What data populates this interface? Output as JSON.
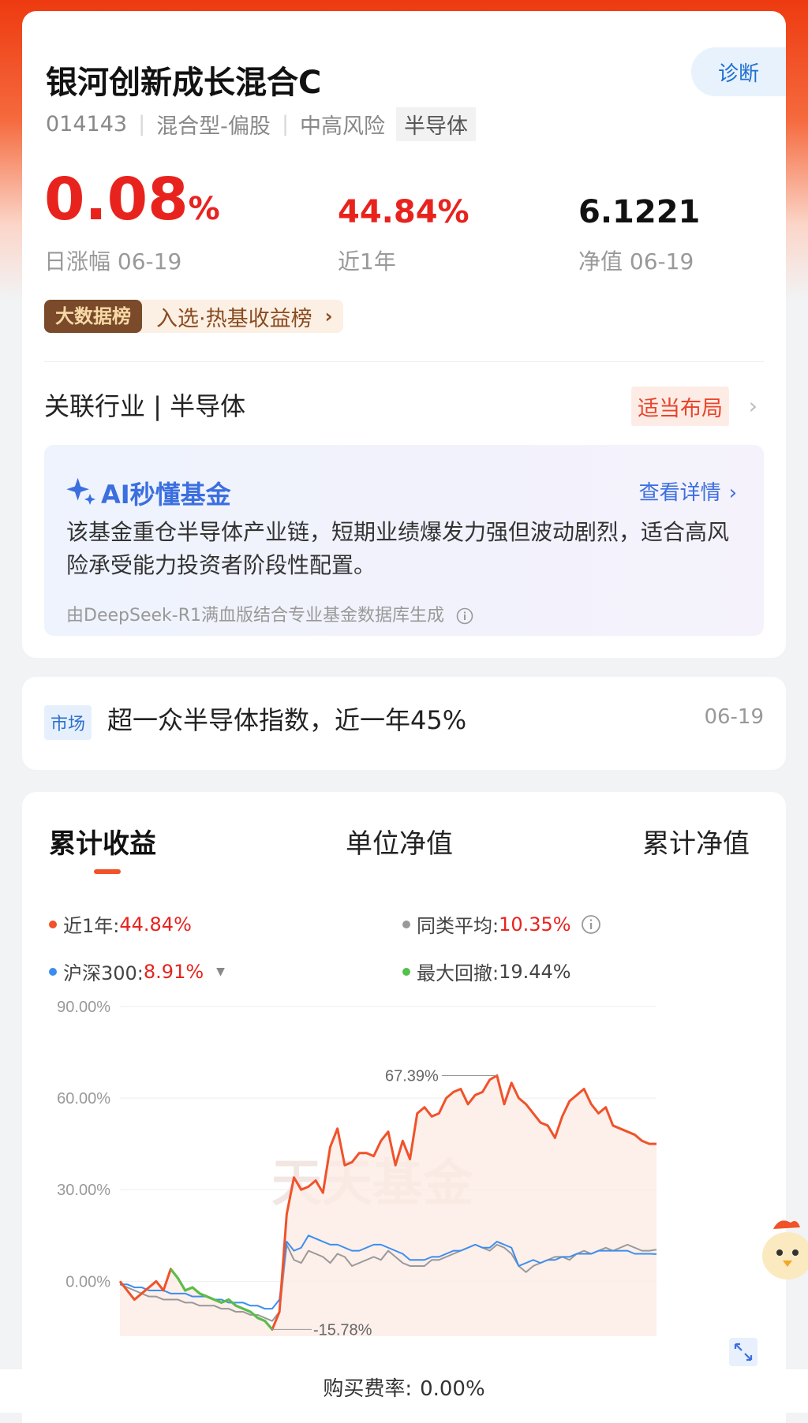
{
  "fund": {
    "name": "银河创新成长混合C",
    "diagnose_label": "诊断",
    "code": "014143",
    "category": "混合型-偏股",
    "risk": "中高风险",
    "theme_tag": "半导体"
  },
  "metrics": {
    "daily_change": "0.08",
    "daily_change_unit": "%",
    "daily_label": "日涨幅 06-19",
    "year_return": "44.84%",
    "year_label": "近1年",
    "nav": "6.1221",
    "nav_label": "净值 06-19"
  },
  "rank": {
    "badge": "大数据榜",
    "text": "入选·热基收益榜"
  },
  "industry": {
    "label": "关联行业 | 半导体",
    "advice": "适当布局"
  },
  "ai": {
    "title": "AI秒懂基金",
    "link": "查看详情",
    "summary": "该基金重仓半导体产业链，短期业绩爆发力强但波动剧烈，适合高风险承受能力投资者阶段性配置。",
    "source": "由DeepSeek-R1满血版结合专业基金数据库生成"
  },
  "market": {
    "tag": "市场",
    "text": "超一众半导体指数，近一年45%",
    "date": "06-19"
  },
  "tabs": [
    "累计收益",
    "单位净值",
    "累计净值"
  ],
  "legend": {
    "fund_label": "近1年:",
    "fund_value": "44.84%",
    "avg_label": "同类平均:",
    "avg_value": "10.35%",
    "hs300_label": "沪深300:",
    "hs300_value": "8.91%",
    "drawdown_label": "最大回撤:",
    "drawdown_value": "19.44%"
  },
  "colors": {
    "fund": "#f0522a",
    "average": "#999999",
    "hs300": "#3b8ef0",
    "drawdown": "#55c04a"
  },
  "chart_data": {
    "type": "line",
    "yticks": [
      "90.00%",
      "60.00%",
      "30.00%",
      "0.00%"
    ],
    "ylim": [
      -18,
      90
    ],
    "annotations": {
      "max": "67.39%",
      "min": "-15.78%"
    },
    "watermark": "天天基金",
    "series": [
      {
        "key": "fund",
        "values": [
          0,
          -3,
          -6,
          -4,
          -2,
          0,
          -3,
          4,
          1,
          -3,
          -2,
          -4,
          -5,
          -6,
          -7,
          -6,
          -8,
          -9,
          -10,
          -12,
          -13,
          -15.78,
          -10,
          22,
          34,
          30,
          31,
          33,
          29,
          44,
          50,
          38,
          39,
          42,
          42,
          41,
          46,
          49,
          38,
          46,
          40,
          55,
          57,
          54,
          55,
          60,
          62,
          63,
          58,
          61,
          62,
          66,
          67.39,
          58,
          65,
          60,
          58,
          55,
          52,
          51,
          47,
          54,
          59,
          61,
          63,
          58,
          55,
          57,
          51,
          50,
          49,
          48,
          46,
          45,
          45
        ]
      },
      {
        "key": "avg",
        "values": [
          -1,
          -2,
          -3,
          -4,
          -5,
          -5,
          -6,
          -6,
          -6,
          -7,
          -7,
          -8,
          -8,
          -8,
          -9,
          -9,
          -10,
          -10,
          -11,
          -11,
          -12,
          -13,
          -10,
          12,
          7,
          6,
          10,
          9,
          8,
          6,
          9,
          8,
          5,
          6,
          7,
          8,
          7,
          10,
          8,
          6,
          5,
          5,
          5,
          7,
          7,
          8,
          9,
          10,
          11,
          12,
          11,
          10,
          12,
          11,
          9,
          5,
          3,
          5,
          6,
          7,
          8,
          8,
          7,
          9,
          10,
          9,
          10,
          11,
          10,
          11,
          12,
          11,
          10,
          10,
          10.35
        ]
      },
      {
        "key": "hs300",
        "values": [
          -1,
          -1,
          -2,
          -2,
          -3,
          -3,
          -3,
          -4,
          -4,
          -4,
          -5,
          -5,
          -5,
          -6,
          -6,
          -7,
          -7,
          -7,
          -8,
          -8,
          -9,
          -9,
          -6,
          13,
          10,
          11,
          15,
          14,
          13,
          12,
          12,
          11,
          10,
          10,
          11,
          12,
          12,
          11,
          10,
          9,
          7,
          7,
          7,
          8,
          8,
          9,
          10,
          10,
          11,
          12,
          11,
          11,
          13,
          12,
          11,
          5,
          6,
          7,
          6,
          7,
          7,
          8,
          8,
          9,
          9,
          9,
          10,
          10,
          10,
          10,
          10,
          9,
          9,
          9,
          8.91
        ]
      }
    ],
    "drawdown_segment": {
      "start_index": 7,
      "end_index": 21
    }
  },
  "fee": {
    "label": "购买费率:",
    "value": "0.00%"
  }
}
